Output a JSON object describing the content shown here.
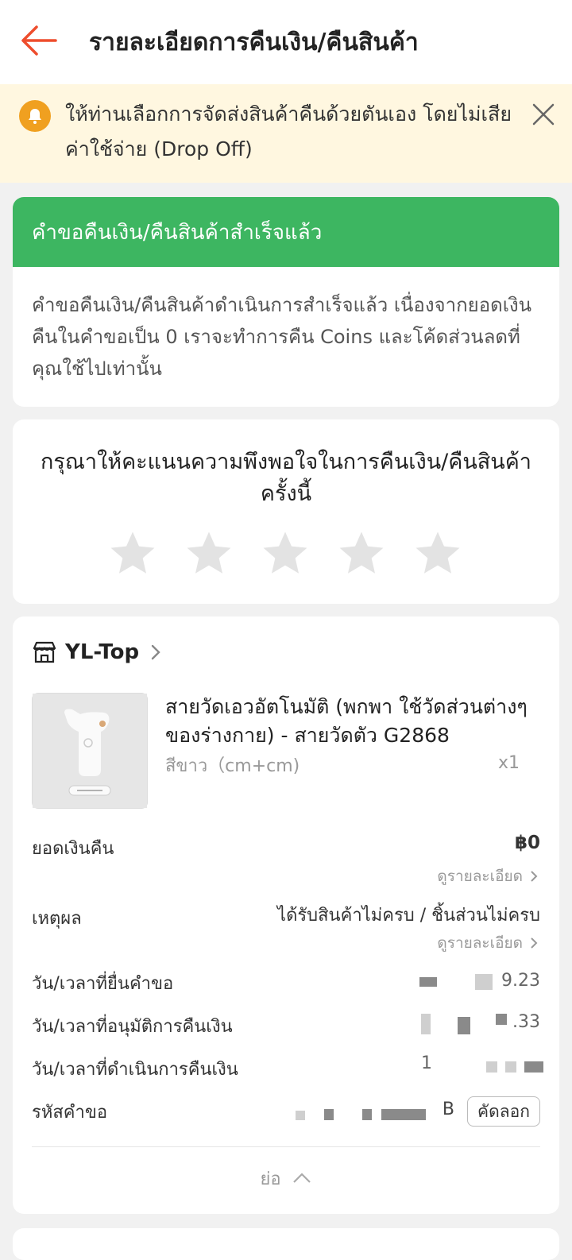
{
  "header": {
    "title": "รายละเอียดการคืนเงิน/คืนสินค้า"
  },
  "notice": {
    "text": "ให้ท่านเลือกการจัดส่งสินค้าคืนด้วยตันเอง โดยไม่เสียค่าใช้จ่าย (Drop Off)"
  },
  "status": {
    "heading": "คำขอคืนเงิน/คืนสินค้าสำเร็จแล้ว",
    "body": "คำขอคืนเงิน/คืนสินค้าดำเนินการสำเร็จแล้ว เนื่องจากยอดเงินคืนในคำขอเป็น 0 เราจะทำการคืน Coins และโค้ดส่วนลดที่คุณใช้ไปเท่านั้น"
  },
  "rating": {
    "question": "กรุณาให้คะแนนความพึงพอใจในการคืนเงิน/คืนสินค้าครั้งนี้",
    "stars_total": 5,
    "stars_selected": 0
  },
  "order": {
    "shop_name": "YL-Top",
    "product_title": "สายวัดเอวอัตโนมัติ (พกพา ใช้วัดส่วนต่างๆ ของร่างกาย) - สายวัดตัว G2868",
    "variant": "สีขาว（cm+cm)",
    "quantity": "x1",
    "refund_label": "ยอดเงินคืน",
    "refund_value": "฿0",
    "view_details": "ดูรายละเอียด",
    "reason_label": "เหตุผล",
    "reason_value": "ได้รับสินค้าไม่ครบ / ชิ้นส่วนไม่ครบ",
    "submitted_label": "วัน/เวลาที่ยื่นคำขอ",
    "submitted_tail": "9.23",
    "approved_label": "วัน/เวลาที่อนุมัติการคืนเงิน",
    "approved_tail": ".33",
    "processed_label": "วัน/เวลาที่ดำเนินการคืนเงิน",
    "processed_head": "1",
    "request_id_label": "รหัสคำขอ",
    "request_id_tail": "B",
    "copy_label": "คัดลอก",
    "collapse_label": "ย่อ"
  },
  "colors": {
    "accent": "#ee4d2d",
    "success": "#3db661",
    "notice_bg": "#fff7e0",
    "bell": "#f0a020"
  }
}
